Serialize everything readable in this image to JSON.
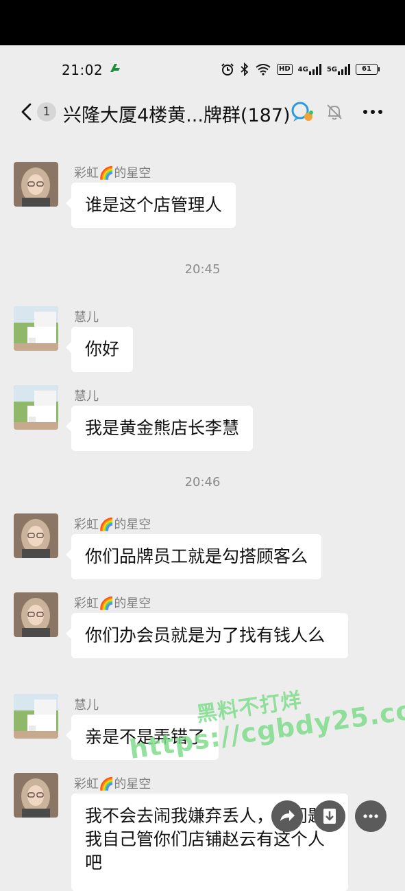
{
  "status_bar": {
    "time": "21:02",
    "hd_label": "HD",
    "network_1": "4G",
    "network_2": "5G",
    "battery": "61"
  },
  "header": {
    "unread_count": "1",
    "title": "兴隆大厦4楼黄...牌群(187)"
  },
  "messages": [
    {
      "type": "message",
      "sender": "彩虹🌈的星空",
      "text": "谁是这个店管理人",
      "avatar": "girl-avatar"
    },
    {
      "type": "time",
      "text": "20:45"
    },
    {
      "type": "message",
      "sender": "慧儿",
      "text": "你好",
      "avatar": "piano-avatar"
    },
    {
      "type": "message",
      "sender": "慧儿",
      "text": "我是黄金熊店长李慧",
      "avatar": "piano-avatar"
    },
    {
      "type": "time",
      "text": "20:46"
    },
    {
      "type": "message",
      "sender": "彩虹🌈的星空",
      "text": "你们品牌员工就是勾搭顾客么",
      "avatar": "girl-avatar"
    },
    {
      "type": "message",
      "sender": "彩虹🌈的星空",
      "text": "你们办会员就是为了找有钱人么",
      "avatar": "girl-avatar"
    },
    {
      "type": "message",
      "sender": "慧儿",
      "text": "亲是不是弄错了",
      "avatar": "piano-avatar"
    },
    {
      "type": "message",
      "sender": "彩虹🌈的星空",
      "text": "我不会去闹我嫌弃丢人，老问题我自己管你们店铺赵云有这个人吧",
      "avatar": "girl-avatar"
    }
  ],
  "watermark": {
    "line1": "黑料不打烊",
    "line2": "https://cgbdy25.com"
  },
  "colors": {
    "background": "#ededed",
    "bubble": "#ffffff",
    "watermark": "#7fdc8c"
  }
}
